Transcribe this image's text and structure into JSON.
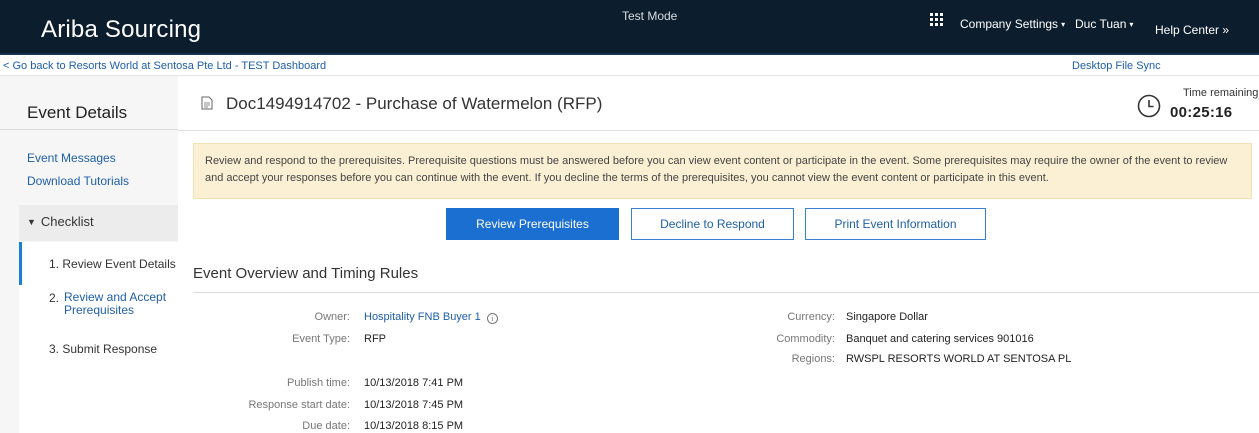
{
  "header": {
    "brand": "Ariba Sourcing",
    "test_mode": "Test Mode",
    "company_settings": "Company Settings",
    "user": "Duc Tuan",
    "help_center": "Help Center",
    "help_chevron": "»",
    "caret": "▾"
  },
  "subheader": {
    "back_link": "< Go back to Resorts World at Sentosa Pte Ltd - TEST Dashboard",
    "desktop_sync": "Desktop File Sync"
  },
  "sidebar": {
    "title": "Event Details",
    "links": [
      "Event Messages",
      "Download Tutorials"
    ],
    "checklist_label": "Checklist",
    "steps": [
      {
        "num": "1.",
        "label": "Review Event Details"
      },
      {
        "num": "2.",
        "label": "Review and Accept Prerequisites"
      },
      {
        "num": "3.",
        "label": "Submit Response"
      }
    ]
  },
  "event": {
    "title": "Doc1494914702 - Purchase of Watermelon (RFP)",
    "time_remaining_label": "Time remaining",
    "time_remaining": "00:25:16"
  },
  "notice": "Review and respond to the prerequisites. Prerequisite questions must be answered before you can view event content or participate in the event. Some prerequisites may require the owner of the event to review and accept your responses before you can continue with the event. If you decline the terms of the prerequisites, you cannot view the event content or participate in this event.",
  "buttons": {
    "review": "Review Prerequisites",
    "decline": "Decline to Respond",
    "print": "Print Event Information"
  },
  "overview": {
    "title": "Event Overview and Timing Rules",
    "owner_label": "Owner:",
    "owner": "Hospitality FNB Buyer 1",
    "event_type_label": "Event Type:",
    "event_type": "RFP",
    "currency_label": "Currency:",
    "currency": "Singapore Dollar",
    "commodity_label": "Commodity:",
    "commodity": "Banquet and catering services 901016",
    "regions_label": "Regions:",
    "regions": "RWSPL RESORTS WORLD AT SENTOSA PL",
    "publish_label": "Publish time:",
    "publish": "10/13/2018 7:41 PM",
    "response_start_label": "Response start date:",
    "response_start": "10/13/2018 7:45 PM",
    "due_label": "Due date:",
    "due": "10/13/2018 8:15 PM"
  }
}
